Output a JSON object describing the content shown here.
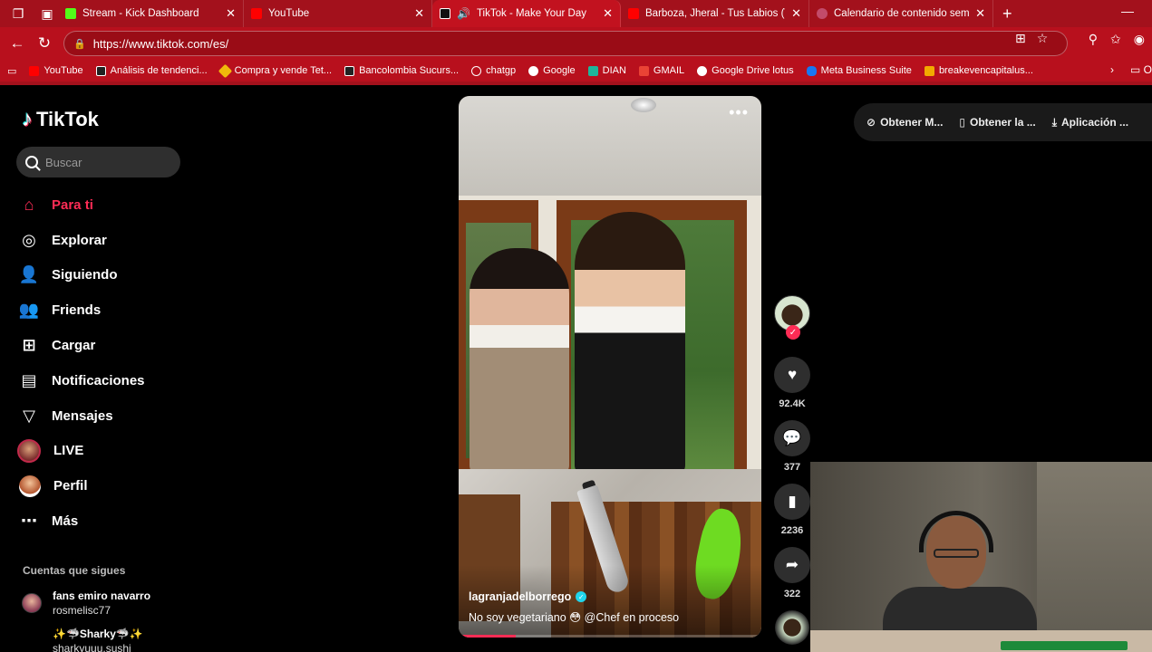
{
  "browser": {
    "tabs": [
      {
        "title": "Stream - Kick Dashboard",
        "color": "#53fc18",
        "active": false
      },
      {
        "title": "YouTube",
        "color": "#ff0000",
        "active": false
      },
      {
        "title": "TikTok - Make Your Day",
        "color": "#111111",
        "active": true
      },
      {
        "title": "Barboza, Jheral - Tus Labios (Vide",
        "color": "#ff0000",
        "active": false
      },
      {
        "title": "Calendario de contenido semanal",
        "color": "#c24b6a",
        "active": false
      }
    ],
    "url": "https://www.tiktok.com/es/",
    "bookmarks": [
      {
        "label": "YouTube",
        "color": "#ff0000"
      },
      {
        "label": "Análisis de tendenci...",
        "color": "#222222"
      },
      {
        "label": "Compra y vende Tet...",
        "color": "#f0b90b"
      },
      {
        "label": "Bancolombia Sucurs...",
        "color": "#222222"
      },
      {
        "label": "chatgp",
        "color": "#ffffff"
      },
      {
        "label": "Google",
        "color": "#4285f4"
      },
      {
        "label": "DIAN",
        "color": "#1fb59a"
      },
      {
        "label": "GMAIL",
        "color": "#ea4335"
      },
      {
        "label": "Google Drive lotus",
        "color": "#4285f4"
      },
      {
        "label": "Meta Business Suite",
        "color": "#1877f2"
      },
      {
        "label": "breakevencapitalus...",
        "color": "#f2a900"
      }
    ],
    "bookmarks_more": "O"
  },
  "tiktok": {
    "logo": "TikTok",
    "search_placeholder": "Buscar",
    "menu": [
      {
        "label": "Para ti",
        "icon": "home-icon",
        "active": true
      },
      {
        "label": "Explorar",
        "icon": "compass-icon",
        "active": false
      },
      {
        "label": "Siguiendo",
        "icon": "following-icon",
        "active": false
      },
      {
        "label": "Friends",
        "icon": "friends-icon",
        "active": false
      },
      {
        "label": "Cargar",
        "icon": "upload-icon",
        "active": false
      },
      {
        "label": "Notificaciones",
        "icon": "notifications-icon",
        "active": false
      },
      {
        "label": "Mensajes",
        "icon": "messages-icon",
        "active": false
      },
      {
        "label": "LIVE",
        "icon": "live-avatar",
        "active": false
      },
      {
        "label": "Perfil",
        "icon": "profile-avatar",
        "active": false
      },
      {
        "label": "Más",
        "icon": "more-icon",
        "active": false
      }
    ],
    "following_title": "Cuentas que sigues",
    "following": [
      {
        "name": "fans emiro navarro",
        "handle": "rosmelisc77"
      },
      {
        "name": "✨🦈Sharky🦈✨",
        "handle": "sharkyuuu.sushi"
      }
    ],
    "video": {
      "author": "lagranjadelborrego",
      "caption": "No soy vegetariano 😳 @Chef en proceso",
      "progress": 0.19
    },
    "actions": {
      "likes": "92.4K",
      "comments": "377",
      "saves": "2236",
      "shares": "322"
    },
    "top_right": [
      {
        "label": "Obtener M...",
        "icon": "coin-icon"
      },
      {
        "label": "Obtener la ...",
        "icon": "phone-icon"
      },
      {
        "label": "Aplicación ...",
        "icon": "download-icon"
      }
    ],
    "accent": "#fe2c55"
  }
}
